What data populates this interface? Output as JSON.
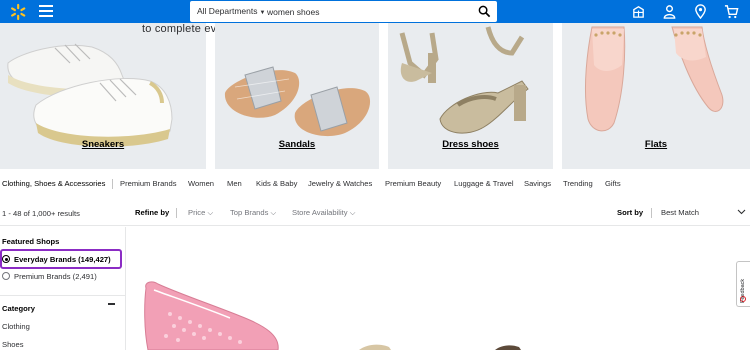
{
  "header": {
    "departments_label": "All Departments",
    "search_value": "women shoes",
    "brand_color": "#0071dc",
    "spark_color": "#ffc220",
    "icons": [
      "spark-logo-icon",
      "hamburger-menu-icon",
      "search-icon",
      "reorder-icon",
      "account-icon",
      "location-pin-icon",
      "cart-icon"
    ]
  },
  "hero": {
    "tagline": "to complete every look.",
    "tiles": [
      {
        "label": "Sneakers"
      },
      {
        "label": "Sandals"
      },
      {
        "label": "Dress shoes"
      },
      {
        "label": "Flats"
      }
    ]
  },
  "category_nav": [
    "Clothing, Shoes & Accessories",
    "Premium Brands",
    "Women",
    "Men",
    "Kids & Baby",
    "Jewelry & Watches",
    "Premium Beauty",
    "Luggage & Travel",
    "Savings",
    "Trending",
    "Gifts"
  ],
  "results": {
    "count_text": "1 - 48 of 1,000+ results",
    "refine_label": "Refine by",
    "filters": [
      "Price",
      "Top Brands",
      "Store Availability"
    ],
    "sort_label": "Sort by",
    "sort_value": "Best Match"
  },
  "sidebar": {
    "featured_heading": "Featured Shops",
    "featured_options": [
      {
        "label": "Everyday Brands (149,427)",
        "selected": true
      },
      {
        "label": "Premium Brands (2,491)",
        "selected": false
      }
    ],
    "highlight_color": "#8b2cc4",
    "category_heading": "Category",
    "category_items": [
      "Clothing",
      "Shoes"
    ]
  },
  "feedback_label": "Feedback"
}
